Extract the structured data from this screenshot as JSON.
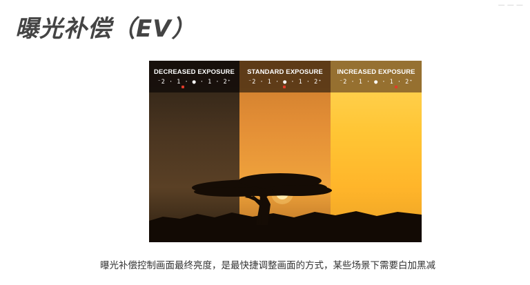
{
  "slide": {
    "title": "曝光补偿（EV）",
    "corner_mark": "—  —  —",
    "caption": "曝光补偿控制画面最终亮度，是最快捷调整画面的方式，某些场景下需要白加黑减"
  },
  "photo": {
    "panels": [
      {
        "label": "DECREASED EXPOSURE",
        "scale": "⁻2 · 1 · ● · 1 · 2⁺",
        "marker_position": "-1"
      },
      {
        "label": "STANDARD EXPOSURE",
        "scale": "⁻2 · 1 · ● · 1 · 2⁺",
        "marker_position": "0"
      },
      {
        "label": "INCREASED EXPOSURE",
        "scale": "⁻2 · 1 · ● · 1 · 2⁺",
        "marker_position": "+1"
      }
    ],
    "colors": {
      "decreased": "#4a3520",
      "standard": "#e38e36",
      "increased": "#ffc534",
      "marker": "#e23b2a"
    }
  }
}
